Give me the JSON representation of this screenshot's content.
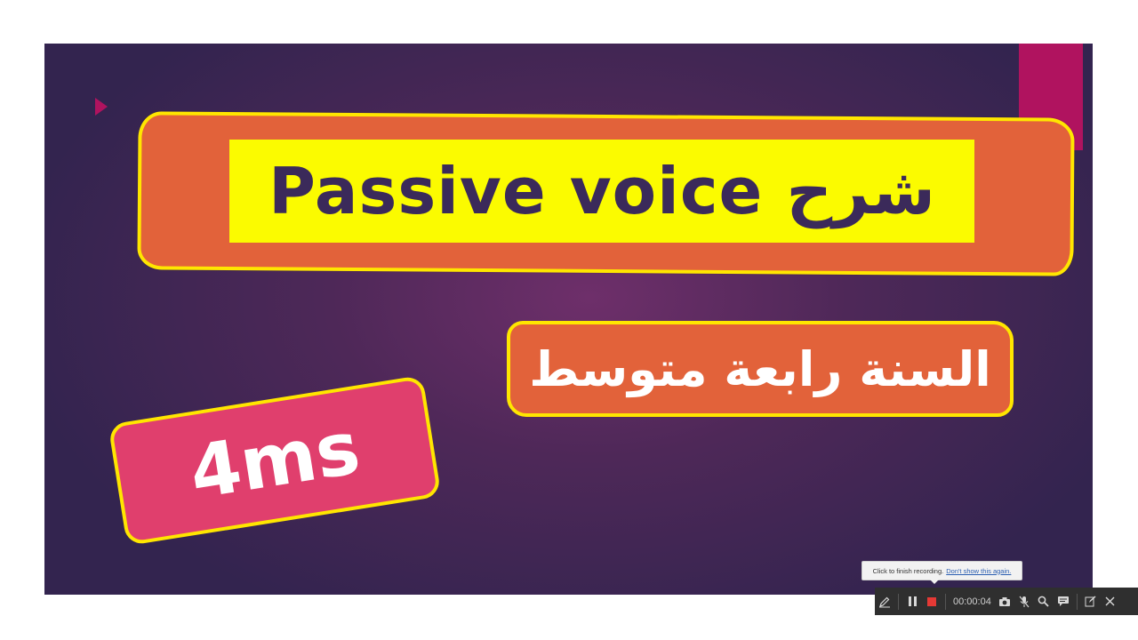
{
  "slide": {
    "title": "Passive voice شرح",
    "subtitle": "السنة رابعة متوسط",
    "badge": "4ms"
  },
  "recorder": {
    "tooltip_text": "Click to finish recording.",
    "tooltip_link": "Don't show this again.",
    "timer": "00:00:04"
  },
  "icons": {
    "pen": "pen-icon",
    "pause": "pause-icon",
    "stop": "stop-icon",
    "camera": "camera-icon",
    "mic": "mic-off-icon",
    "zoom": "zoom-icon",
    "captions": "captions-icon",
    "edit": "edit-icon",
    "close": "close-icon"
  },
  "colors": {
    "slide_background": "#4e2858",
    "title_box": "#e2623a",
    "title_highlight": "#fbfb00",
    "title_text": "#3b2a5a",
    "outline": "#ffe600",
    "badge": "#e03f6d",
    "accent": "#b0135f",
    "stop": "#e53935"
  }
}
